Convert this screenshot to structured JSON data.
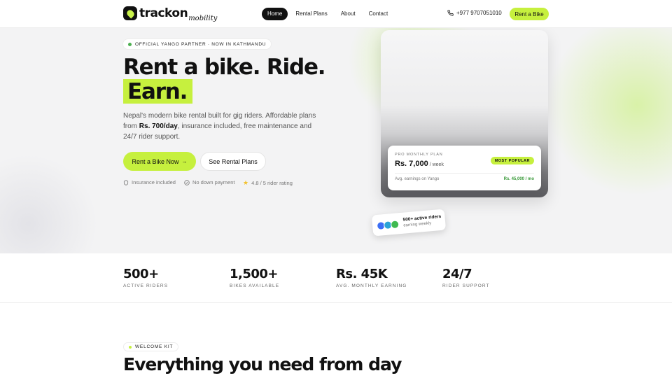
{
  "brand": {
    "name": "trackon",
    "sub": "mobility"
  },
  "nav": {
    "items": [
      {
        "label": "Home",
        "active": true
      },
      {
        "label": "Rental Plans",
        "active": false
      },
      {
        "label": "About",
        "active": false
      },
      {
        "label": "Contact",
        "active": false
      }
    ],
    "phone": "+977 9707051010",
    "cta": "Rent a Bike"
  },
  "hero": {
    "badge": "OFFICIAL YANGO PARTNER · NOW IN KATHMANDU",
    "title_line1": "Rent a bike. Ride.",
    "title_highlight": "Earn.",
    "desc_pre": "Nepal's modern bike rental built for gig riders. Affordable plans from ",
    "desc_bold": "Rs. 700/day",
    "desc_post": ", insurance included, free maintenance and 24/7 rider support.",
    "primary_cta": "Rent a Bike Now",
    "secondary_cta": "See Rental Plans",
    "trust": [
      "Insurance included",
      "No down payment",
      "4.8 / 5 rider rating"
    ]
  },
  "plan_card": {
    "label": "PRO MONTHLY PLAN",
    "price": "Rs. 7,000",
    "unit": "/ week",
    "pill": "MOST POPULAR",
    "earnings_label": "Avg. earnings on Yango",
    "earnings_value": "Rs. 45,000 / mo"
  },
  "riders_badge": {
    "title": "500+ active riders",
    "subtitle": "earning weekly"
  },
  "stats": [
    {
      "value": "500+",
      "label": "ACTIVE RIDERS"
    },
    {
      "value": "1,500+",
      "label": "BIKES AVAILABLE"
    },
    {
      "value": "Rs. 45K",
      "label": "AVG. MONTHLY EARNING"
    },
    {
      "value": "24/7",
      "label": "RIDER SUPPORT"
    }
  ],
  "welcome": {
    "badge": "WELCOME KIT",
    "title": "Everything you need from day"
  },
  "colors": {
    "accent": "#c6f03e",
    "dark": "#111111",
    "green_dot": "#4caf50",
    "earnings": "#3a9a3a"
  },
  "avatar_colors": [
    "#3b6ef5",
    "#2aa3d6",
    "#3fb950"
  ]
}
